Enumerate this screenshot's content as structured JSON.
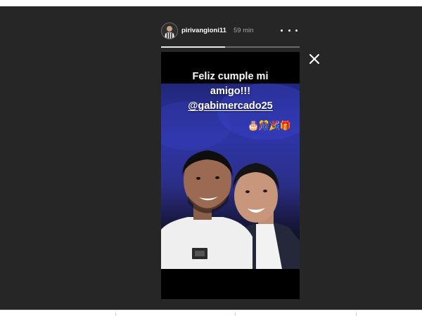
{
  "story": {
    "username": "pirivangioni11",
    "timestamp": "59 min",
    "progress": 0.46,
    "caption_line1": "Feliz cumple mi",
    "caption_line2": "amigo!!!",
    "mention": "@gabimercado25",
    "emojis": "🎂🎊🎉🎁"
  },
  "colors": {
    "viewer_background": "#262626",
    "photo_blue": "#2d35a6"
  },
  "icons": {
    "more": "more-icon",
    "close": "close-icon",
    "avatar": "avatar"
  }
}
